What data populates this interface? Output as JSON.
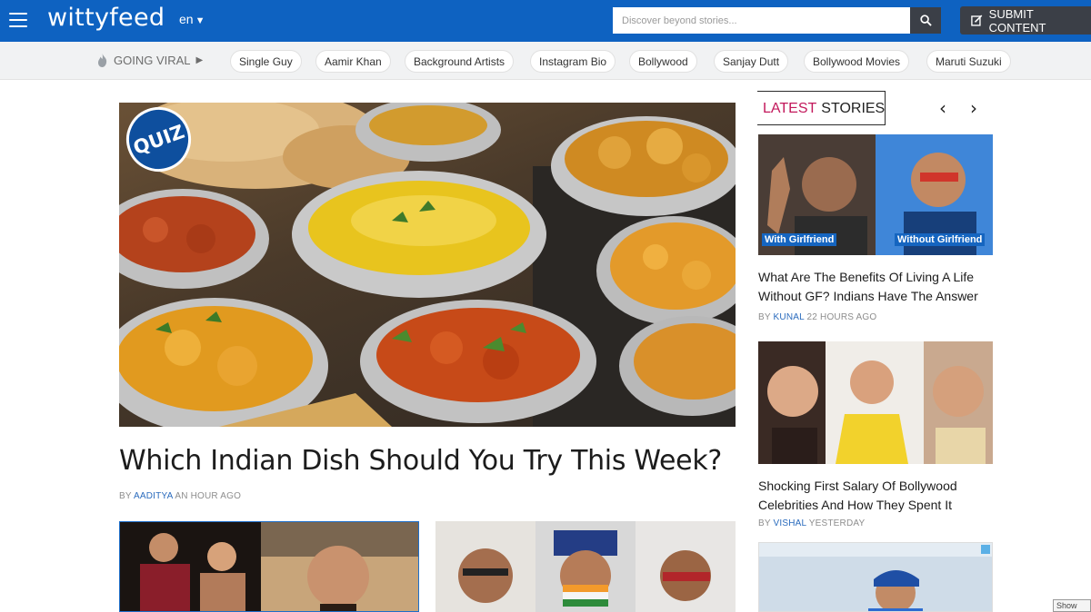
{
  "header": {
    "logo": "wittyfeed",
    "language": "en",
    "search_placeholder": "Discover beyond stories...",
    "submit_label": "SUBMIT CONTENT"
  },
  "viral": {
    "label": "GOING VIRAL",
    "tags": [
      "Single Guy",
      "Aamir Khan",
      "Background Artists",
      "Instagram Bio",
      "Bollywood",
      "Sanjay Dutt",
      "Bollywood Movies",
      "Maruti Suzuki"
    ]
  },
  "hero": {
    "badge": "QUIZ",
    "title": "Which Indian Dish Should You Try This Week?",
    "byline": "BY",
    "author": "AADITYA",
    "time": "AN HOUR AGO"
  },
  "sidebar": {
    "heading_accent": "LATEST",
    "heading_rest": "STORIES",
    "prev_icon": "chevron-left-icon",
    "next_icon": "chevron-right-icon",
    "stories": [
      {
        "caption_left": "With Girlfriend",
        "caption_right": "Without Girlfriend",
        "title": "What Are The Benefits Of Living A Life Without GF? Indians Have The Answer",
        "byline": "BY",
        "author": "KUNAL",
        "time": "22 HOURS AGO"
      },
      {
        "title": "Shocking First Salary Of Bollywood Celebrities And How They Spent It",
        "byline": "BY",
        "author": "VISHAL",
        "time": "YESTERDAY"
      }
    ]
  },
  "footer_tip": "Show all"
}
